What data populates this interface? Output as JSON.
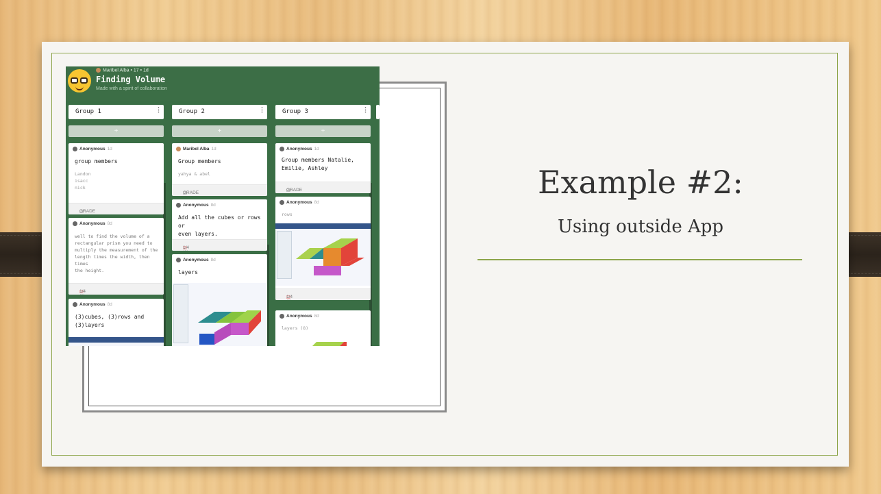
{
  "slide": {
    "title": "Example #2:",
    "subtitle": "Using outside App"
  },
  "padlet": {
    "author": "Maribel Alba",
    "meta": "• 17 • 1d",
    "title": "Finding Volume",
    "subtitle": "Made with a spirit of collaboration",
    "add_label": "+",
    "more_label": "⋮",
    "columns": [
      {
        "name": "Group 1",
        "cards": [
          {
            "author": "Anonymous",
            "ago": "1d",
            "title": "group members",
            "body": [
              "Landon",
              "isacc",
              "nick"
            ],
            "footer": "GRADE"
          },
          {
            "author": "Anonymous",
            "ago": "8d",
            "body": [
              "well to find the volume of a",
              "rectangular prism you need to",
              "multiply the measurement of the",
              "length times the width, then times",
              "the height."
            ],
            "footer": "1/4 (1)"
          },
          {
            "author": "Anonymous",
            "ago": "8d",
            "title": [
              "(3)cubes, (3)rows and",
              "(3)layers"
            ]
          }
        ]
      },
      {
        "name": "Group 2",
        "cards": [
          {
            "author": "Maribel Alba",
            "ago": "1d",
            "title": "Group members",
            "body": [
              "yahya & abel"
            ],
            "footer": "GRADE"
          },
          {
            "author": "Anonymous",
            "ago": "8d",
            "title": [
              "Add all the cubes or rows or",
              "even layers."
            ],
            "footer": "1/4 (1)"
          },
          {
            "author": "Anonymous",
            "ago": "8d",
            "title": "layers"
          }
        ]
      },
      {
        "name": "Group 3",
        "cards": [
          {
            "author": "Anonymous",
            "ago": "1d",
            "title": [
              "Group members Natalie,",
              "Emilie, Ashley"
            ],
            "footer": "GRADE"
          },
          {
            "author": "Anonymous",
            "ago": "8d",
            "body": [
              "rows"
            ],
            "footer": "1/4 (1)"
          },
          {
            "author": "Anonymous",
            "ago": "8d",
            "body": [
              "layers (8)"
            ]
          }
        ]
      }
    ]
  },
  "colors": {
    "padlet_green": "#3c6e46",
    "accent_line": "#8da54a",
    "grade_check_red": "#e24b4b"
  }
}
